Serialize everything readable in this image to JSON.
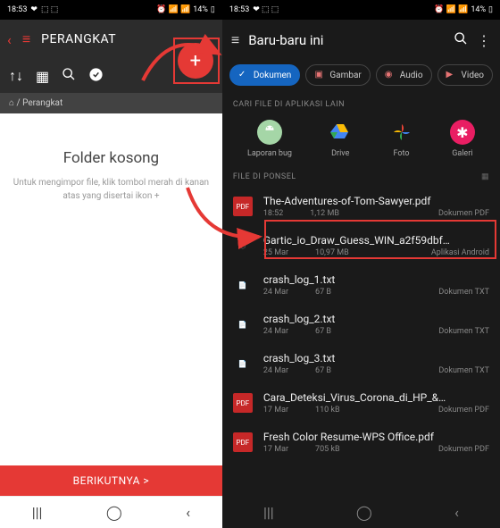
{
  "status": {
    "time": "18:53",
    "battery": "14%"
  },
  "left": {
    "header": {
      "title": "PERANGKAT"
    },
    "breadcrumb": "⌂ / Perangkat",
    "empty": {
      "title": "Folder kosong",
      "subtitle": "Untuk mengimpor file, klik tombol merah di kanan atas yang disertai ikon +"
    },
    "footer_next": "BERIKUTNYA >"
  },
  "right": {
    "header": {
      "title": "Baru-baru ini"
    },
    "chips": [
      {
        "label": "Dokumen",
        "active": true,
        "icon": "check"
      },
      {
        "label": "Gambar",
        "active": false,
        "icon": "image"
      },
      {
        "label": "Audio",
        "active": false,
        "icon": "audio"
      },
      {
        "label": "Video",
        "active": false,
        "icon": "video"
      }
    ],
    "section_other_apps": "CARI FILE DI APLIKASI LAIN",
    "apps": [
      {
        "label": "Laporan bug",
        "icon": "android"
      },
      {
        "label": "Drive",
        "icon": "drive"
      },
      {
        "label": "Foto",
        "icon": "photos"
      },
      {
        "label": "Galeri",
        "icon": "gallery"
      }
    ],
    "section_phone_files": "FILE DI PONSEL",
    "files": [
      {
        "name": "The-Adventures-of-Tom-Sawyer.pdf",
        "date": "18:52",
        "size": "1,12 MB",
        "type": "Dokumen PDF",
        "icon": "pdf"
      },
      {
        "name": "Gartic_io_Draw_Guess_WIN_a2f59dbf…",
        "date": "25 Mar",
        "size": "10,97 MB",
        "type": "Aplikasi Android",
        "icon": "apk"
      },
      {
        "name": "crash_log_1.txt",
        "date": "24 Mar",
        "size": "67 B",
        "type": "Dokumen TXT",
        "icon": "txt"
      },
      {
        "name": "crash_log_2.txt",
        "date": "24 Mar",
        "size": "67 B",
        "type": "Dokumen TXT",
        "icon": "txt"
      },
      {
        "name": "crash_log_3.txt",
        "date": "24 Mar",
        "size": "67 B",
        "type": "Dokumen TXT",
        "icon": "txt"
      },
      {
        "name": "Cara_Deteksi_Virus_Corona_di_HP_&…",
        "date": "17 Mar",
        "size": "110 kB",
        "type": "Dokumen PDF",
        "icon": "pdf"
      },
      {
        "name": "Fresh Color Resume-WPS Office.pdf",
        "date": "17 Mar",
        "size": "705 kB",
        "type": "Dokumen PDF",
        "icon": "pdf"
      }
    ]
  }
}
